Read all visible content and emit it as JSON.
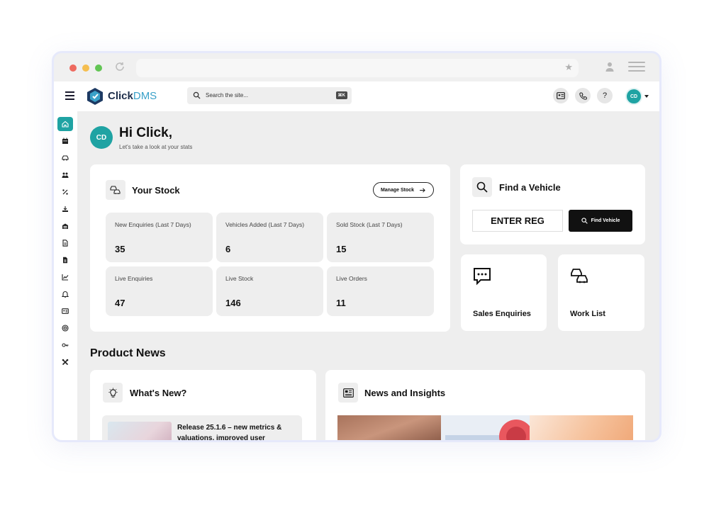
{
  "browser": {
    "title": "",
    "url": ""
  },
  "app": {
    "brand_prefix": "Click",
    "brand_suffix": "DMS",
    "search_placeholder": "Search the site...",
    "search_shortcut": "⌘K",
    "help_label": "?",
    "user_initials": "CD",
    "accent_color": "#1fa3a3"
  },
  "sidebar": {
    "items": [
      {
        "icon": "home-icon",
        "active": true
      },
      {
        "icon": "calendar-icon",
        "active": false
      },
      {
        "icon": "car-icon",
        "active": false
      },
      {
        "icon": "people-icon",
        "active": false
      },
      {
        "icon": "percent-icon",
        "active": false
      },
      {
        "icon": "download-icon",
        "active": false
      },
      {
        "icon": "garage-icon",
        "active": false
      },
      {
        "icon": "document-icon",
        "active": false
      },
      {
        "icon": "invoice-icon",
        "active": false
      },
      {
        "icon": "chart-icon",
        "active": false
      },
      {
        "icon": "bell-icon",
        "active": false
      },
      {
        "icon": "id-card-icon",
        "active": false
      },
      {
        "icon": "target-icon",
        "active": false
      },
      {
        "icon": "key-icon",
        "active": false
      },
      {
        "icon": "tools-icon",
        "active": false
      }
    ]
  },
  "greeting": {
    "initials": "CD",
    "title": "Hi Click,",
    "subtitle": "Let's take a look at your stats"
  },
  "stock": {
    "title": "Your Stock",
    "manage_label": "Manage Stock",
    "stats": [
      {
        "label": "New Enquiries (Last 7 Days)",
        "value": "35"
      },
      {
        "label": "Vehicles Added (Last 7 Days)",
        "value": "6"
      },
      {
        "label": "Sold Stock (Last 7 Days)",
        "value": "15"
      },
      {
        "label": "Live Enquiries",
        "value": "47"
      },
      {
        "label": "Live Stock",
        "value": "146"
      },
      {
        "label": "Live Orders",
        "value": "11"
      }
    ]
  },
  "find_vehicle": {
    "title": "Find a Vehicle",
    "reg_placeholder": "ENTER REG",
    "button_label": "Find Vehicle"
  },
  "tiles": {
    "sales_enquiries": "Sales Enquiries",
    "work_list": "Work List"
  },
  "product_news": {
    "heading": "Product News",
    "whats_new_title": "What's New?",
    "release_text": "Release 25.1.6 – new metrics & valuations, improved user",
    "news_title": "News and Insights"
  }
}
